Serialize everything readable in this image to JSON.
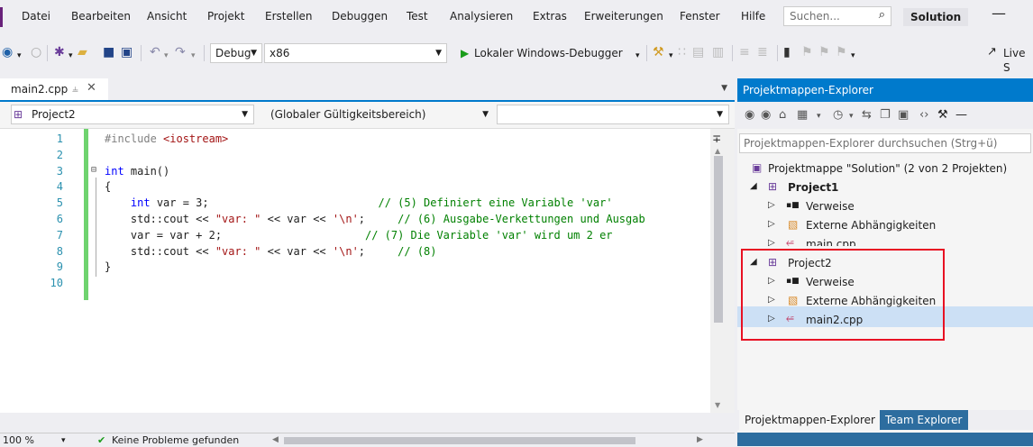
{
  "menu": {
    "items": [
      "Datei",
      "Bearbeiten",
      "Ansicht",
      "Projekt",
      "Erstellen",
      "Debuggen",
      "Test",
      "Analysieren",
      "Extras",
      "Erweiterungen",
      "Fenster",
      "Hilfe"
    ],
    "search_placeholder": "Suchen...",
    "solution_name": "Solution",
    "minimize": "—"
  },
  "toolbar": {
    "config": "Debug",
    "platform": "x86",
    "debugger": "Lokaler Windows-Debugger",
    "live_share": "Live S"
  },
  "document": {
    "tab_label": "main2.cpp",
    "project_combo": "Project2",
    "scope_combo": "(Globaler Gültigkeitsbereich)"
  },
  "editor": {
    "line_numbers": [
      "1",
      "2",
      "3",
      "4",
      "5",
      "6",
      "7",
      "8",
      "9",
      "10"
    ],
    "lines": [
      {
        "segments": [
          {
            "t": "#include ",
            "c": "pre"
          },
          {
            "t": "<iostream>",
            "c": "str"
          }
        ]
      },
      {
        "segments": []
      },
      {
        "segments": [
          {
            "t": "int",
            "c": "kw"
          },
          {
            "t": " main()",
            "c": ""
          }
        ]
      },
      {
        "segments": [
          {
            "t": "{",
            "c": ""
          }
        ]
      },
      {
        "segments": [
          {
            "t": "    ",
            "c": ""
          },
          {
            "t": "int",
            "c": "kw"
          },
          {
            "t": " var = 3;                          ",
            "c": ""
          },
          {
            "t": "// (5) Definiert eine Variable 'var'",
            "c": "cmt"
          }
        ]
      },
      {
        "segments": [
          {
            "t": "    std::cout << ",
            "c": ""
          },
          {
            "t": "\"var: \"",
            "c": "str"
          },
          {
            "t": " << var << ",
            "c": ""
          },
          {
            "t": "'\\n'",
            "c": "str"
          },
          {
            "t": ";     ",
            "c": ""
          },
          {
            "t": "// (6) Ausgabe-Verkettungen und Ausgab",
            "c": "cmt"
          }
        ]
      },
      {
        "segments": [
          {
            "t": "    var = var + 2;                      ",
            "c": ""
          },
          {
            "t": "// (7) Die Variable 'var' wird um 2 er",
            "c": "cmt"
          }
        ]
      },
      {
        "segments": [
          {
            "t": "    std::cout << ",
            "c": ""
          },
          {
            "t": "\"var: \"",
            "c": "str"
          },
          {
            "t": " << var << ",
            "c": ""
          },
          {
            "t": "'\\n'",
            "c": "str"
          },
          {
            "t": ";     ",
            "c": ""
          },
          {
            "t": "// (8)",
            "c": "cmt"
          }
        ]
      },
      {
        "segments": [
          {
            "t": "}",
            "c": ""
          }
        ]
      },
      {
        "segments": []
      }
    ]
  },
  "status": {
    "zoom": "100 %",
    "problems": "Keine Probleme gefunden"
  },
  "solution_explorer": {
    "title": "Projektmappen-Explorer",
    "search_placeholder": "Projektmappen-Explorer durchsuchen (Strg+ü)",
    "solution_label": "Projektmappe \"Solution\" (2 von 2 Projekten)",
    "project1": "Project1",
    "project2": "Project2",
    "references": "Verweise",
    "external_deps": "Externe Abhängigkeiten",
    "main_cpp": "main.cpp",
    "main2_cpp": "main2.cpp",
    "tab_solution_explorer": "Projektmappen-Explorer",
    "tab_team_explorer": "Team Explorer"
  },
  "colors": {
    "accent_blue": "#007acc",
    "change_bar": "#6fd36f",
    "highlight_box": "#e81123"
  }
}
